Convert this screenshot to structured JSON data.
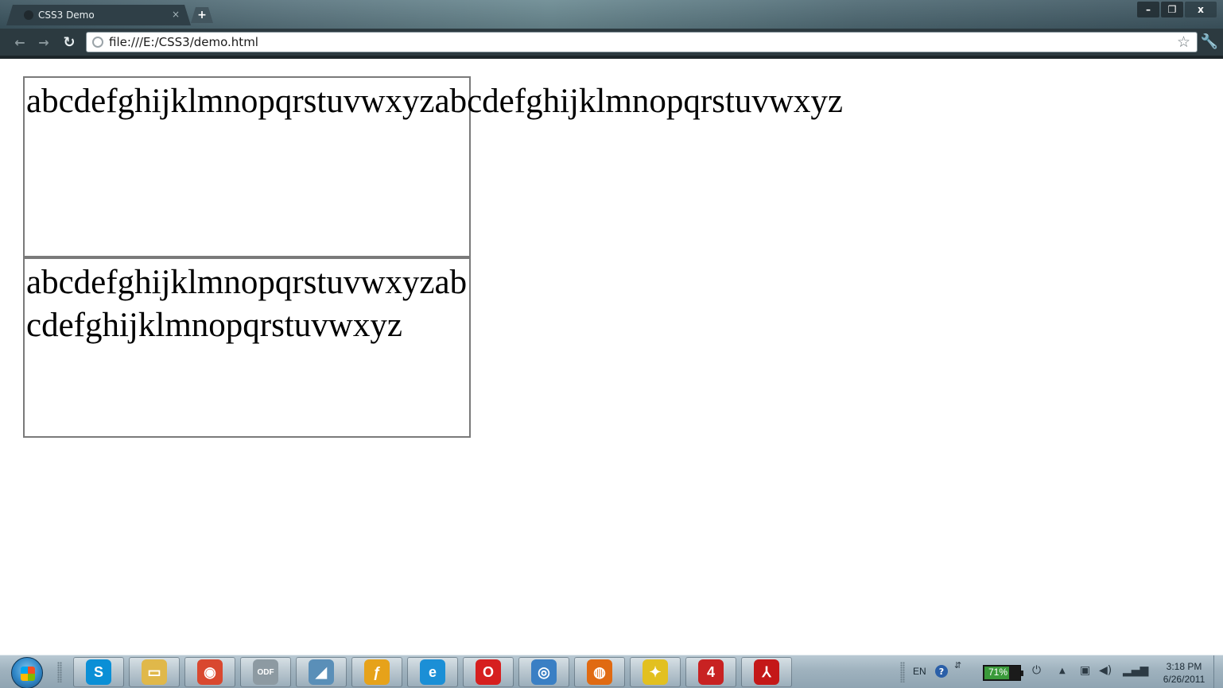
{
  "browser": {
    "tab_title": "CSS3 Demo",
    "tab_close_glyph": "×",
    "new_tab_glyph": "+",
    "url": "file:///E:/CSS3/demo.html",
    "window_controls": [
      "–",
      "❐",
      "x"
    ]
  },
  "page": {
    "box1_text": "abcdefghijklmnopqrstuvwxyzabcdefghijklmnopqrstuvwxyz",
    "box2_text": "abcdefghijklmnopqrstuvwxyzabcdefghijklmnopqrstuvwxyz"
  },
  "taskbar": {
    "apps": [
      {
        "name": "skype",
        "label": "S",
        "color": "#0a8fd6"
      },
      {
        "name": "file-manager",
        "label": "▭",
        "color": "#e0b84a"
      },
      {
        "name": "chrome",
        "label": "◉",
        "color": "#d9482f"
      },
      {
        "name": "odf-viewer",
        "label": "ODF",
        "color": "#8d9aa2"
      },
      {
        "name": "notes",
        "label": "◢",
        "color": "#5a8fb8"
      },
      {
        "name": "flash",
        "label": "ƒ",
        "color": "#e6a21a"
      },
      {
        "name": "internet-explorer",
        "label": "e",
        "color": "#1b8fd6"
      },
      {
        "name": "opera",
        "label": "O",
        "color": "#d61f1f"
      },
      {
        "name": "safari",
        "label": "◎",
        "color": "#3a7fc4"
      },
      {
        "name": "firefox",
        "label": "◍",
        "color": "#e06a12"
      },
      {
        "name": "bird-app",
        "label": "✦",
        "color": "#e2c020"
      },
      {
        "name": "red-app",
        "label": "4",
        "color": "#c82222"
      },
      {
        "name": "acrobat",
        "label": "⅄",
        "color": "#c41818"
      }
    ],
    "language": "EN",
    "help_label": "?",
    "battery_percent": "71%",
    "battery_level": 0.71,
    "time": "3:18 PM",
    "date": "6/26/2011"
  }
}
